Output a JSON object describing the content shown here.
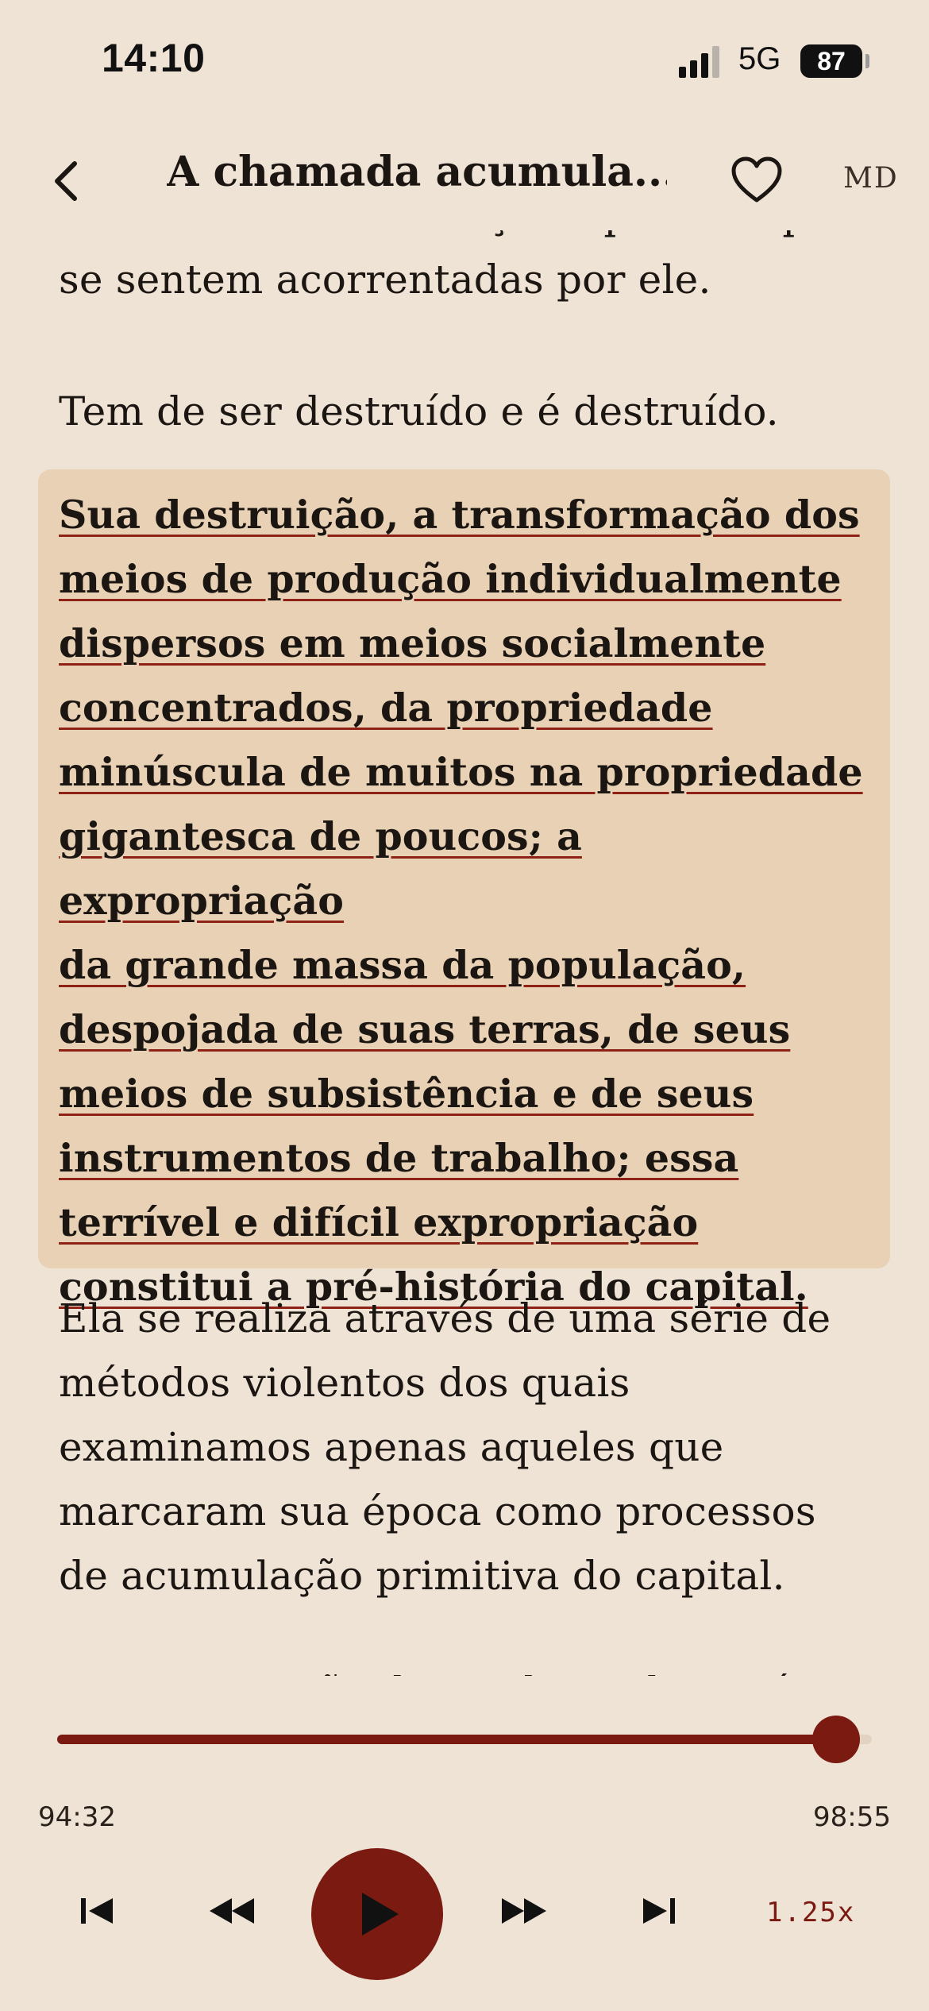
{
  "status_bar": {
    "time": "14:10",
    "network": "5G",
    "battery": "87"
  },
  "header": {
    "title": "A chamada acumula...",
    "format_label": "MD",
    "icons": {
      "back": "chevron-left-icon",
      "favorite": "heart-icon"
    }
  },
  "content": {
    "para_top": "seio da sociedade forças e paixões que se sentem acorrentadas por ele.",
    "para_2": "Tem de ser destruído e é destruído.",
    "highlight_lines": [
      "Sua destruição, a transformação dos",
      "meios de produção individualmente",
      "dispersos em meios socialmente",
      "concentrados, da propriedade",
      "minúscula de muitos na propriedade",
      "gigantesca de poucos; a expropriação",
      "da grande massa da população,",
      "despojada de suas terras, de seus",
      "meios de subsistência e de seus",
      "instrumentos de trabalho; essa",
      "terrível e difícil expropriação",
      "constitui a pré-história do capital."
    ],
    "para_4": "Ela se realiza através de uma série de métodos violentos dos quais examinamos apenas aqueles que marcaram sua época como processos de acumulação primitiva do capital.",
    "para_5": "A expropriação do produtor direto é"
  },
  "player": {
    "elapsed": "94:32",
    "total": "98:55",
    "progress": 0.956,
    "speed": "1.25x",
    "accent_color": "#7A1A10",
    "icons": {
      "prev": "skip-previous-icon",
      "rewind": "rewind-icon",
      "play": "play-icon",
      "forward": "fast-forward-icon",
      "next": "skip-next-icon"
    }
  }
}
